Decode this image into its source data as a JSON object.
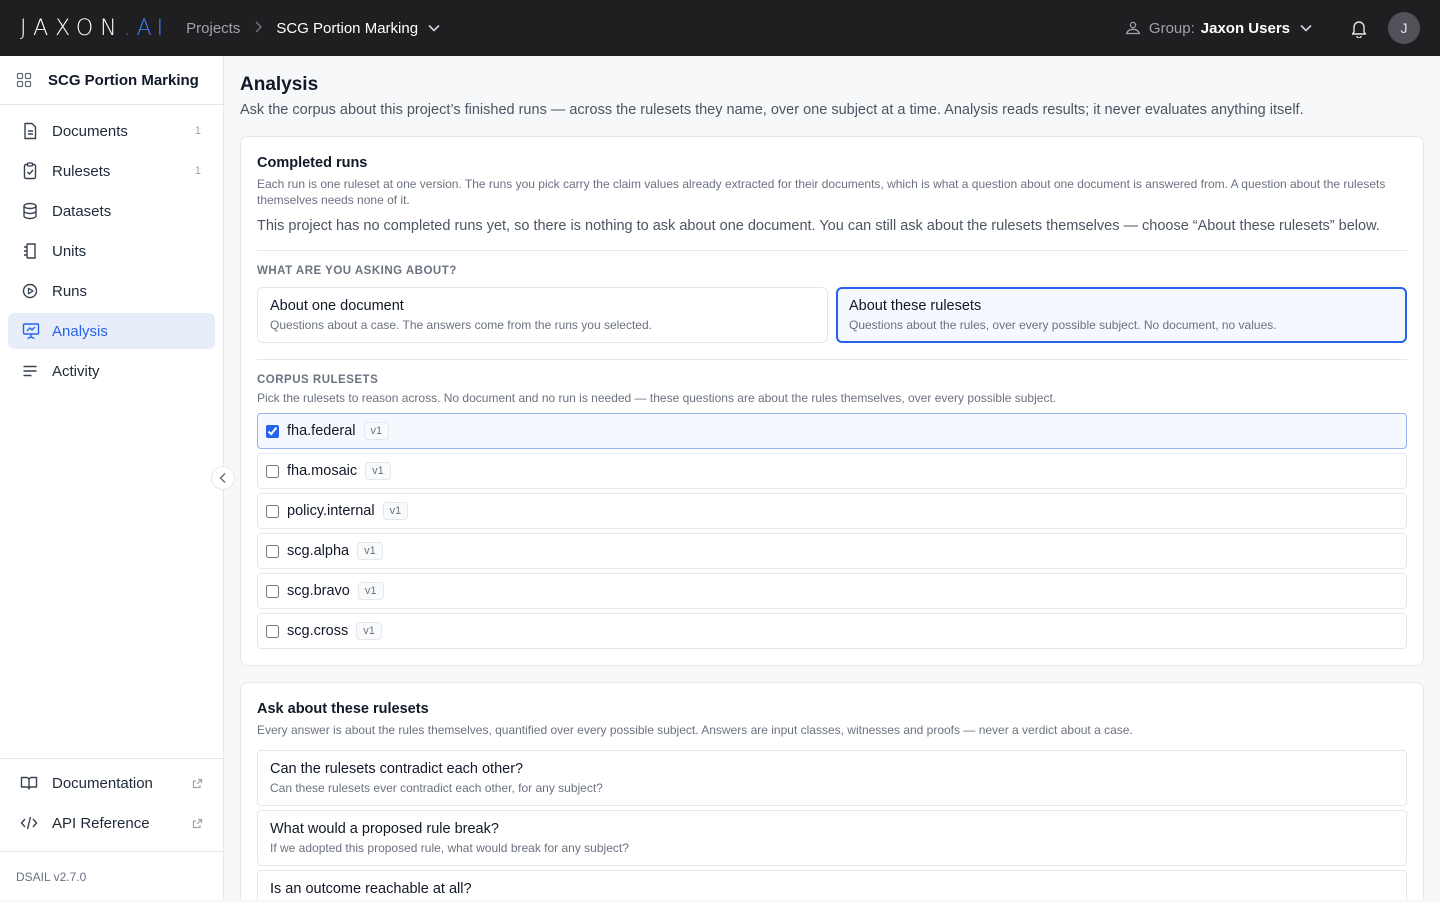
{
  "topbar": {
    "logo_main": "JAXON",
    "logo_dot": ".",
    "logo_ai": "AI",
    "crumb_projects": "Projects",
    "crumb_current": "SCG Portion Marking",
    "group_label": "Group:",
    "group_name": "Jaxon Users",
    "avatar_initial": "J"
  },
  "sidebar": {
    "project_name": "SCG Portion Marking",
    "items": [
      {
        "label": "Documents",
        "count": "1",
        "icon": "document-icon"
      },
      {
        "label": "Rulesets",
        "count": "1",
        "icon": "clipboard-check-icon"
      },
      {
        "label": "Datasets",
        "count": "",
        "icon": "database-icon"
      },
      {
        "label": "Units",
        "count": "",
        "icon": "units-icon"
      },
      {
        "label": "Runs",
        "count": "",
        "icon": "play-circle-icon"
      },
      {
        "label": "Analysis",
        "count": "",
        "icon": "presentation-chart-icon"
      },
      {
        "label": "Activity",
        "count": "",
        "icon": "activity-lines-icon"
      }
    ],
    "bottom_links": [
      {
        "label": "Documentation",
        "icon": "book-icon"
      },
      {
        "label": "API Reference",
        "icon": "code-icon"
      }
    ],
    "version": "DSAIL v2.7.0"
  },
  "main": {
    "title": "Analysis",
    "subtitle": "Ask the corpus about this project’s finished runs — across the rulesets they name, over one subject at a time. Analysis reads results; it never evaluates anything itself.",
    "completed_runs": {
      "title": "Completed runs",
      "description": "Each run is one ruleset at one version. The runs you pick carry the claim values already extracted for their documents, which is what a question about one document is answered from. A question about the rulesets themselves needs none of it.",
      "note": "This project has no completed runs yet, so there is nothing to ask about one document. You can still ask about the rulesets themselves — choose “About these rulesets” below.",
      "asking_label": "WHAT ARE YOU ASKING ABOUT?",
      "choices": [
        {
          "title": "About one document",
          "desc": "Questions about a case. The answers come from the runs you selected."
        },
        {
          "title": "About these rulesets",
          "desc": "Questions about the rules, over every possible subject. No document, no values."
        }
      ],
      "corpus_label": "CORPUS RULESETS",
      "corpus_desc": "Pick the rulesets to reason across. No document and no run is needed — these questions are about the rules themselves, over every possible subject.",
      "rulesets": [
        {
          "name": "fha.federal",
          "version": "v1",
          "checked": true
        },
        {
          "name": "fha.mosaic",
          "version": "v1",
          "checked": false
        },
        {
          "name": "policy.internal",
          "version": "v1",
          "checked": false
        },
        {
          "name": "scg.alpha",
          "version": "v1",
          "checked": false
        },
        {
          "name": "scg.bravo",
          "version": "v1",
          "checked": false
        },
        {
          "name": "scg.cross",
          "version": "v1",
          "checked": false
        }
      ]
    },
    "ask": {
      "title": "Ask about these rulesets",
      "description": "Every answer is about the rules themselves, quantified over every possible subject. Answers are input classes, witnesses and proofs — never a verdict about a case.",
      "questions": [
        {
          "title": "Can the rulesets contradict each other?",
          "desc": "Can these rulesets ever contradict each other, for any subject?"
        },
        {
          "title": "What would a proposed rule break?",
          "desc": "If we adopted this proposed rule, what would break for any subject?"
        },
        {
          "title": "Is an outcome reachable at all?",
          "desc": ""
        }
      ]
    }
  }
}
